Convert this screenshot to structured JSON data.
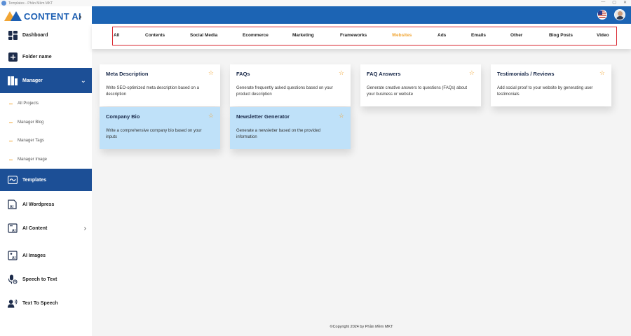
{
  "window": {
    "title": "Templates - Phần Mềm MKT",
    "controls": [
      "—",
      "▢",
      "✕"
    ]
  },
  "brand": {
    "name": "CONTENT AI",
    "collapse_icon": "chevron-right-icon"
  },
  "sidebar": {
    "items": [
      {
        "label": "Dashboard",
        "icon": "dashboard-icon"
      },
      {
        "label": "Folder name",
        "icon": "plus-icon"
      },
      {
        "label": "Manager",
        "icon": "manager-icon"
      },
      {
        "label": "Templates",
        "icon": "templates-icon"
      },
      {
        "label": "AI Wordpress",
        "icon": "ai-wordpress-icon"
      },
      {
        "label": "AI Content",
        "icon": "ai-content-icon"
      },
      {
        "label": "AI Images",
        "icon": "ai-images-icon"
      },
      {
        "label": "Speech to Text",
        "icon": "microphone-icon"
      },
      {
        "label": "Text To Speech",
        "icon": "speaker-person-icon"
      }
    ],
    "sub_items": [
      "All Projects",
      "Manager Blog",
      "Manager Tags",
      "Manager Image"
    ]
  },
  "categories": {
    "tabs": [
      "All",
      "Contents",
      "Social Media",
      "Ecommerce",
      "Marketing",
      "Frameworks",
      "Websites",
      "Ads",
      "Emails",
      "Other",
      "Blog Posts",
      "Video"
    ],
    "active": "Websites"
  },
  "cards": [
    {
      "title": "Meta Description",
      "desc": "Write SEO-optimized meta description based on a description"
    },
    {
      "title": "FAQs",
      "desc": "Generate frequently asked questions based on your product description"
    },
    {
      "title": "FAQ Answers",
      "desc": "Generate creative answers to questions (FAQs) about your business or website"
    },
    {
      "title": "Testimonials / Reviews",
      "desc": "Add social proof to your website by generating user testimonials"
    },
    {
      "title": "Company Bio",
      "desc": "Write a comprehensive company bio based on your inputs"
    },
    {
      "title": "Newsletter Generator",
      "desc": "Generate a newsletter based on the provided information"
    }
  ],
  "footer": {
    "text": "©Copyright 2024 by Phần Mềm MKT"
  },
  "colors": {
    "primary": "#1c64b4",
    "sidebar_active": "#1c4f96",
    "accent": "#f1a534",
    "card_highlight": "#bfe1f9",
    "tabs_border": "#d9262f"
  }
}
